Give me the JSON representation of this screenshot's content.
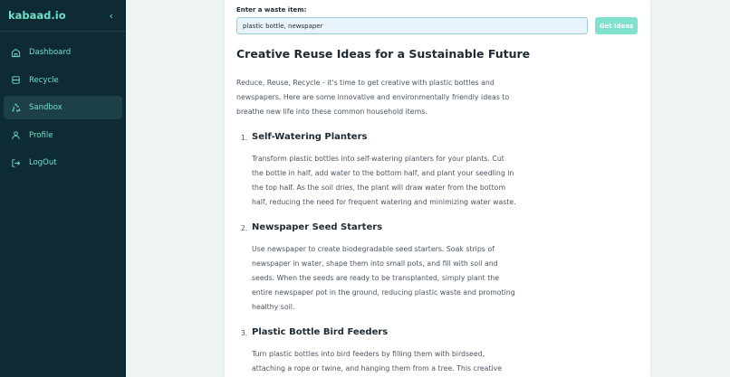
{
  "sidebar": {
    "brand": "kabaad.io",
    "collapse_icon": "chevron-left",
    "items": [
      {
        "label": "Dashboard",
        "icon": "home"
      },
      {
        "label": "Recycle",
        "icon": "layers"
      },
      {
        "label": "Sandbox",
        "icon": "recycle",
        "active": true
      },
      {
        "label": "Profile",
        "icon": "user"
      },
      {
        "label": "LogOut",
        "icon": "logout"
      }
    ]
  },
  "form": {
    "label": "Enter a waste item:",
    "value": "plastic bottle, newspaper",
    "button": "Get Ideas"
  },
  "article": {
    "title": "Creative Reuse Ideas for a Sustainable Future",
    "intro": "Reduce, Reuse, Recycle - it's time to get creative with plastic bottles and newspapers. Here are some innovative and environmentally friendly ideas to breathe new life into these common household items.",
    "ideas": [
      {
        "num": "1.",
        "title": "Self-Watering Planters",
        "text": "Transform plastic bottles into self-watering planters for your plants. Cut the bottle in half, add water to the bottom half, and plant your seedling in the top half. As the soil dries, the plant will draw water from the bottom half, reducing the need for frequent watering and minimizing water waste."
      },
      {
        "num": "2.",
        "title": "Newspaper Seed Starters",
        "text": "Use newspaper to create biodegradable seed starters. Soak strips of newspaper in water, shape them into small pots, and fill with soil and seeds. When the seeds are ready to be transplanted, simply plant the entire newspaper pot in the ground, reducing plastic waste and promoting healthy soil."
      },
      {
        "num": "3.",
        "title": "Plastic Bottle Bird Feeders",
        "text": "Turn plastic bottles into bird feeders by filling them with birdseed, attaching a rope or twine, and hanging them from a tree. This creative"
      }
    ]
  },
  "colors": {
    "sidebar_bg": "#0e2a33",
    "accent": "#6fe0c9",
    "button": "#80e1cf",
    "page_bg": "#eef4f2"
  }
}
